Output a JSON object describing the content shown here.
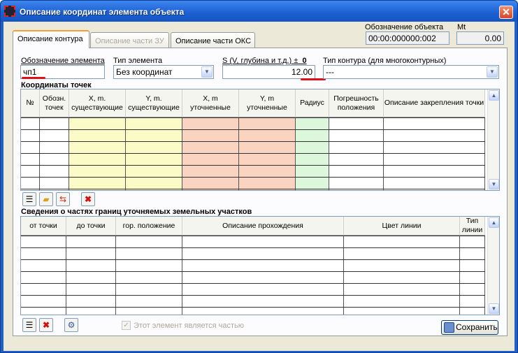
{
  "window": {
    "title": "Описание координат элемента объекта",
    "close_label": "✕"
  },
  "tabs": [
    {
      "label": "Описание контура",
      "state": "active"
    },
    {
      "label": "Описание части ЗУ",
      "state": "disabled"
    },
    {
      "label": "Описание части ОКС",
      "state": "normal"
    }
  ],
  "object": {
    "designation_label": "Обозначение объекта",
    "designation_value": "00:00:000000:002",
    "mt_label": "Mt",
    "mt_value": "0.00"
  },
  "form": {
    "element_designation_label": "Обозначение элемента",
    "element_designation_value": "чп1",
    "element_type_label": "Тип элемента",
    "element_type_value": "Без координат",
    "area_label": "S (V, глубина и т.д.) ±",
    "area_pm_value": "0",
    "area_value": "12.00",
    "contour_type_label": "Тип контура (для многоконтурных)",
    "contour_type_value": "---"
  },
  "points": {
    "title": "Координаты точек",
    "columns": [
      "№",
      "Обозн. точек",
      "X, m. существующие",
      "Y, m. существующие",
      "X, m уточненные",
      "Y, m уточненные",
      "Радиус",
      "Погрешность положения",
      "Описание закрепления точки"
    ]
  },
  "parts": {
    "title": "Сведения о частях границ уточняемых земельных участков",
    "columns": [
      "от точки",
      "до точки",
      "гор. положение",
      "Описание прохождения",
      "Цвет линии",
      "Тип линии"
    ]
  },
  "footer": {
    "checkbox_label": "Этот элемент является частью",
    "checkbox_checked": true,
    "save_label": "Сохранить"
  },
  "colors": {
    "yellow_col": "#fbfbc8",
    "red_col": "#fbd3c1",
    "green_col": "#dcf7dc",
    "annotation": "#e0101a"
  }
}
